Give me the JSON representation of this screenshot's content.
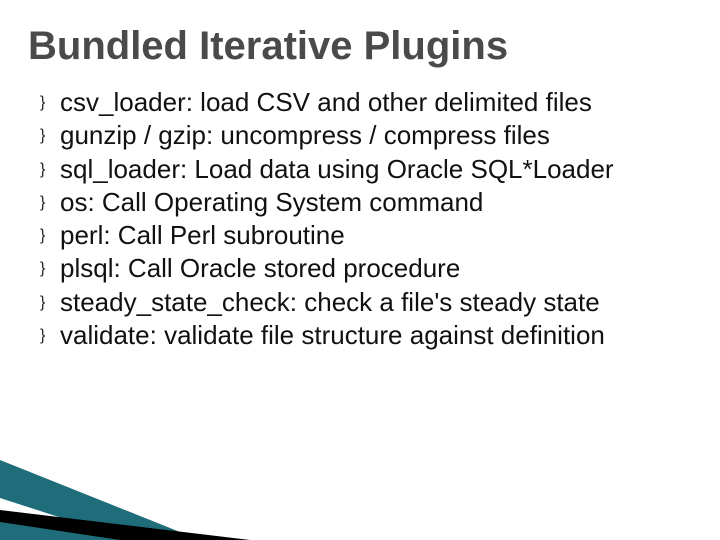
{
  "title": "Bundled Iterative Plugins",
  "bullet_glyph": "}",
  "items": [
    "csv_loader: load CSV and other delimited files",
    "gunzip / gzip: uncompress / compress files",
    "sql_loader: Load data using Oracle SQL*Loader",
    "os: Call Operating System command",
    "perl: Call Perl subroutine",
    "plsql: Call Oracle stored procedure",
    "steady_state_check: check a file's steady state",
    "validate: validate file structure against definition"
  ],
  "decoration_colors": {
    "teal": "#1f6d7a",
    "black": "#000000",
    "white": "#ffffff"
  }
}
